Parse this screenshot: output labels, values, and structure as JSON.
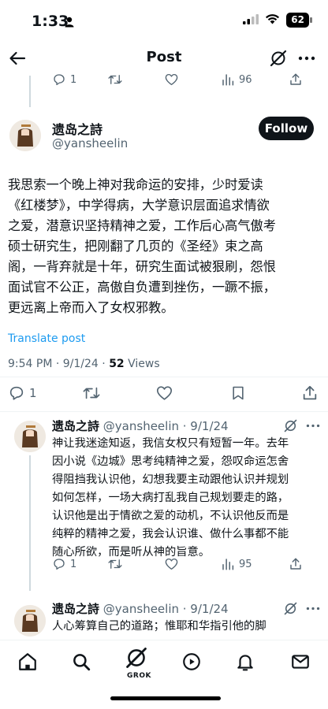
{
  "status_bar": {
    "time": "1:33",
    "battery": "62"
  },
  "nav": {
    "title": "Post"
  },
  "prev_tweet_actions": {
    "replies": "1",
    "views": "96"
  },
  "main_tweet": {
    "name": "遗岛之詩",
    "handle": "@yansheelin",
    "follow_label": "Follow",
    "lines": [
      "我思索一个晚上神对我命运的安排，少时爱读",
      "《红楼梦》，中学得病，大学意识层面追求情欲",
      "之爱，潜意识坚持精神之爱，工作后心高气傲考",
      "硕士研究生，把刚翻了几页的《圣经》束之高",
      "阁，一背弃就是十年，研究生面试被狠刷，怨恨",
      "面试官不公正，高傲自负遭到挫伤，一蹶不振，",
      "更远离上帝而入了女权邪教。"
    ],
    "translate_label": "Translate post",
    "timestamp": "9:54 PM · 9/1/24 · ",
    "views_count": "52",
    "views_label": " Views",
    "replies": "1"
  },
  "replies": [
    {
      "name": "遗岛之詩",
      "handle": "@yansheelin · 9/1/24",
      "lines": [
        "神让我迷途知返，我信女权只有短暂一年。去年",
        "因小说《边城》思考纯精神之爱，怨叹命运怎舍",
        "得阻挡我认识他，幻想我要主动跟他认识并规划",
        "如何怎样，一场大病打乱我自己规划要走的路，",
        "认识他是出于情欲之爱的动机，不认识他反而是",
        "纯粹的精神之爱，我会认识谁、做什么事都不能",
        "随心所欲，而是听从神的旨意。"
      ],
      "replies": "1",
      "views": "95"
    },
    {
      "name": "遗岛之詩",
      "handle": "@yansheelin · 9/1/24",
      "lines": [
        "人心筹算自己的道路；惟耶和华指引他的脚"
      ]
    }
  ],
  "tabbar": {
    "grok_label": "GROK"
  },
  "icons": [
    "back-arrow-icon",
    "grok-icon",
    "more-icon",
    "reply-icon",
    "repost-icon",
    "like-icon",
    "views-icon",
    "bookmark-icon",
    "share-icon",
    "home-icon",
    "search-icon",
    "video-icon",
    "notifications-icon",
    "messages-icon"
  ],
  "colors": {
    "link": "#1d9bf0",
    "secondary_text": "#536471",
    "primary_text": "#0f1419",
    "follow_bg": "#0f1419"
  }
}
